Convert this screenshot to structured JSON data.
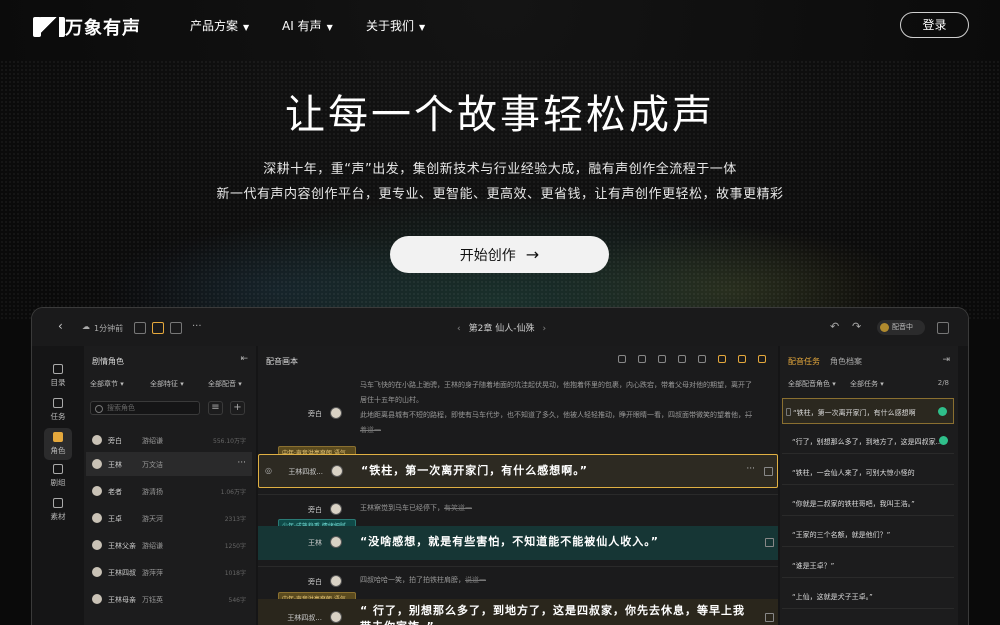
{
  "nav": {
    "brand": "万象有声",
    "menu": [
      "产品方案",
      "AI 有声",
      "关于我们"
    ],
    "login_label": "登录"
  },
  "hero": {
    "title": "让每一个故事轻松成声",
    "line1": "深耕十年，重“声”出发，集创新技术与行业经验大成，融有声创作全流程于一体",
    "line2": "新一代有声内容创作平台，更专业、更智能、更高效、更省钱，让有声创作更轻松，故事更精彩",
    "cta_label": "开始创作",
    "cta_arrow": "→"
  },
  "app": {
    "saved_time": "1分钟前",
    "chapter": "第2章  仙人-仙殊",
    "status": "配音中",
    "rail": [
      {
        "label": "目录"
      },
      {
        "label": "任务"
      },
      {
        "label": "角色"
      },
      {
        "label": "剧组"
      },
      {
        "label": "素材"
      }
    ],
    "roles_panel": {
      "title": "剧情角色",
      "filter_chapter": "全部章节 ▾",
      "filter_trait": "全部特征 ▾",
      "filter_dub": "全部配音 ▾",
      "search_placeholder": "搜索角色",
      "rows": [
        {
          "name": "旁白",
          "voice": "游绍谦",
          "count": "556.10万字"
        },
        {
          "name": "王林",
          "voice": "万文洁",
          "count": "···"
        },
        {
          "name": "老者",
          "voice": "游清扬",
          "count": "1.06万字"
        },
        {
          "name": "王卓",
          "voice": "游天河",
          "count": "2313字"
        },
        {
          "name": "王林父亲",
          "voice": "游绍谦",
          "count": "1250字"
        },
        {
          "name": "王林四叔",
          "voice": "游萍萍",
          "count": "1018字"
        },
        {
          "name": "王林母亲",
          "voice": "万钰英",
          "count": "546字"
        }
      ]
    },
    "script_panel": {
      "title": "配音画本",
      "lines": [
        {
          "speaker": "旁白",
          "text": "马车飞快的在小路上驰骋，王林的身子随着地面的坑洼起伏晃动，他抱着怀里的包裹，内心跌宕，带着父母对他的期望，离开了居住十五年的山村。",
          "text2": "此地距离县城有不短的路程，即使有马车代步，也不知道了多久，他被人轻轻推动，睁开眼睛一看，四叔面带微笑的望着他，",
          "strike": "打着道一"
        },
        {
          "tag": "中年·声音洪亮爽朗,语气...",
          "speaker": "王林四叔...",
          "text": "“铁柱，第一次离开家门，有什么感想啊。”"
        },
        {
          "speaker": "旁白",
          "text": "王林察觉到马车已经停下，",
          "strike": "有笑道一"
        },
        {
          "tag": "少年·成熟稳重,情绪细腻...",
          "speaker": "王林",
          "text": "“没啥感想，就是有些害怕，不知道能不能被仙人收入。”"
        },
        {
          "speaker": "旁白",
          "text": "四叔哈哈一笑，拍了拍铁柱肩膀，",
          "strike": "说道一"
        },
        {
          "tag": "中年·声音洪亮爽朗,语气...",
          "speaker": "王林四叔...",
          "text": "“ 行了，别想那么多了，到地方了，这是四叔家，你先去休息，等早上我带去你家族。”"
        }
      ]
    },
    "tasks_panel": {
      "tabs": [
        "配音任务",
        "角色档案"
      ],
      "filter_role": "全部配音角色 ▾",
      "filter_task": "全部任务 ▾",
      "progress": "2/8",
      "items": [
        {
          "text": "“铁柱，第一次离开家门，有什么感想啊",
          "done": true
        },
        {
          "text": "“行了，别想那么多了，到地方了，这是四叔家...",
          "done": true
        },
        {
          "text": "“铁柱，一会仙人来了，可别大惊小怪的",
          "done": false
        },
        {
          "text": "“你就是二叔家的铁柱哥吧，我叫王浩。”",
          "done": false
        },
        {
          "text": "“王家的三个名额，就是他们？”",
          "done": false
        },
        {
          "text": "“谁是王卓？”",
          "done": false
        },
        {
          "text": "“上仙，这就是犬子王卓。”",
          "done": false
        }
      ]
    }
  }
}
